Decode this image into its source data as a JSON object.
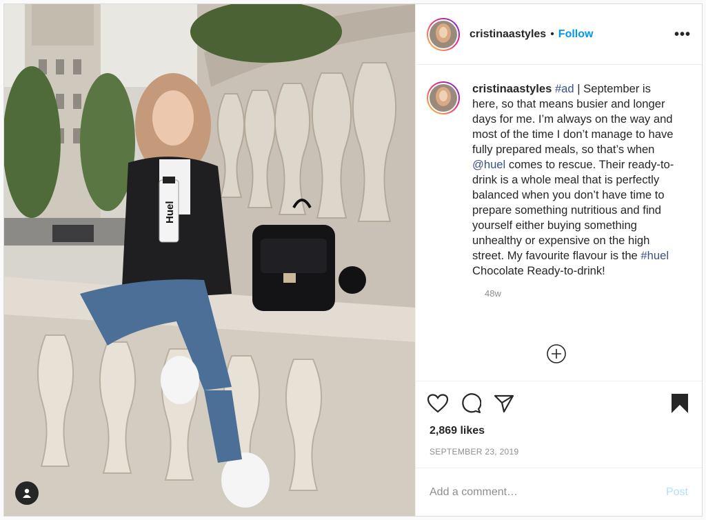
{
  "post": {
    "username": "cristinaastyles",
    "follow_label": "Follow",
    "separator": "•",
    "more_label": "•••",
    "caption": {
      "username": "cristinaastyles",
      "seg1": "#ad",
      "seg2": " | September is here, so that means busier and longer days for me. I’m always on the way and most of the time I don’t manage to have fully prepared meals, so that’s when ",
      "seg3": "@huel",
      "seg4": " comes to rescue. Their ready-to-drink is a whole meal that is perfectly balanced when you don’t have time to prepare something nutritious and find yourself either buying something unhealthy or expensive on the high street. My favourite flavour is the ",
      "seg5": "#huel",
      "seg6": " Chocolate Ready-to-drink!"
    },
    "timestamp": "48w",
    "likes": "2,869 likes",
    "date": "SEPTEMBER 23, 2019",
    "comment_placeholder": "Add a comment…",
    "post_label": "Post",
    "bottle_label": "Huel"
  },
  "icons": {
    "like": "heart-icon",
    "comment": "comment-icon",
    "share": "share-icon",
    "save": "bookmark-icon",
    "load_more": "plus-circle-icon",
    "tags": "user-tag-icon"
  },
  "colors": {
    "accent": "#0095f6",
    "link": "#385185",
    "muted": "#8e8e8e",
    "post_disabled": "#b2dffc"
  }
}
